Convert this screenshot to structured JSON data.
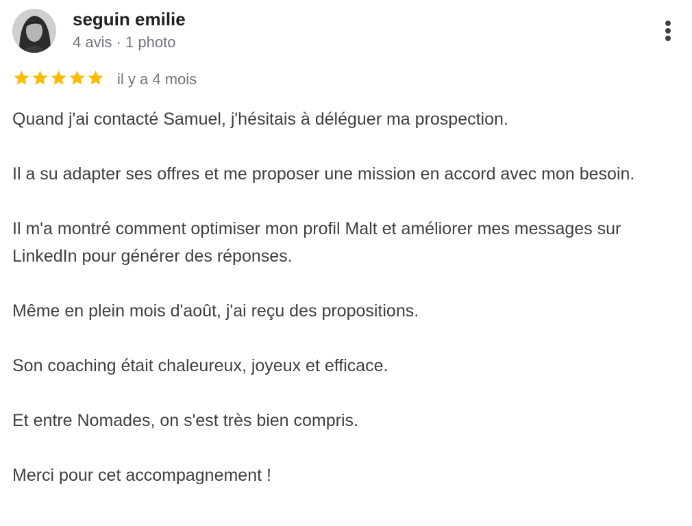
{
  "review": {
    "author": {
      "name": "seguin emilie",
      "meta": "4 avis · 1 photo",
      "avatar_icon": "user-avatar"
    },
    "rating": {
      "stars": 5,
      "max": 5,
      "star_color": "#fbbc04"
    },
    "date": "il y a 4 mois",
    "more_icon": "more-vert-icon",
    "paragraphs": [
      "Quand j'ai contacté Samuel, j'hésitais à déléguer ma prospection.",
      "Il a su adapter ses offres et me proposer une mission en accord avec mon besoin.",
      "Il m'a montré comment optimiser mon profil Malt et améliorer mes messages sur LinkedIn pour générer des réponses.",
      "Même en plein mois d'août, j'ai reçu des propositions.",
      "Son coaching était chaleureux, joyeux et efficace.",
      "Et entre Nomades, on s'est très bien compris.",
      "Merci pour cet accompagnement !"
    ]
  }
}
